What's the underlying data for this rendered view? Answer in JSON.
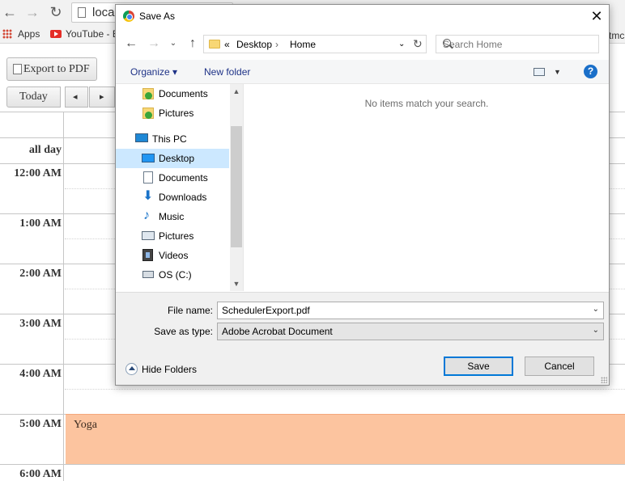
{
  "browser": {
    "address": "loca",
    "bookmarks": {
      "apps": "Apps",
      "youtube": "YouTube - Bro",
      "right_fragment": "tmc"
    }
  },
  "page": {
    "export_button": "Export to PDF",
    "today_button": "Today",
    "prev_glyph": "◂",
    "next_glyph": "▸",
    "all_day": "all day",
    "times": [
      "12:00 AM",
      "1:00 AM",
      "2:00 AM",
      "3:00 AM",
      "4:00 AM",
      "5:00 AM",
      "6:00 AM"
    ],
    "event": "Yoga",
    "colors": {
      "event": "#fcc49f"
    }
  },
  "dialog": {
    "title": "Save As",
    "close_glyph": "✕",
    "path": {
      "prefix": "«",
      "segments": [
        "Desktop",
        "Home"
      ]
    },
    "search_placeholder": "Search Home",
    "toolbar": {
      "organize": "Organize ▾",
      "new_folder": "New folder",
      "help": "?"
    },
    "nav_items": [
      {
        "label": "Documents",
        "icon": "synced-folder-icon"
      },
      {
        "label": "Pictures",
        "icon": "synced-folder-icon"
      },
      {
        "label": "This PC",
        "icon": "computer-icon"
      },
      {
        "label": "Desktop",
        "icon": "desktop-icon",
        "selected": true
      },
      {
        "label": "Documents",
        "icon": "documents-icon"
      },
      {
        "label": "Downloads",
        "icon": "downloads-icon"
      },
      {
        "label": "Music",
        "icon": "music-icon"
      },
      {
        "label": "Pictures",
        "icon": "pictures-icon"
      },
      {
        "label": "Videos",
        "icon": "videos-icon"
      },
      {
        "label": "OS (C:)",
        "icon": "drive-icon"
      }
    ],
    "empty_message": "No items match your search.",
    "file_name_label": "File name:",
    "file_name_value": "SchedulerExport.pdf",
    "save_type_label": "Save as type:",
    "save_type_value": "Adobe Acrobat Document",
    "hide_folders": "Hide Folders",
    "save": "Save",
    "cancel": "Cancel"
  }
}
